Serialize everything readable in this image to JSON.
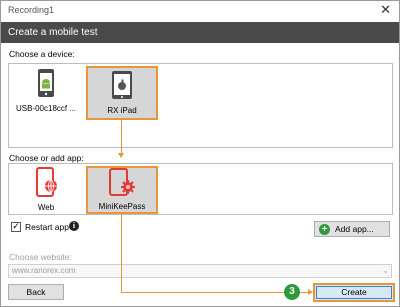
{
  "window": {
    "title": "Recording1",
    "close_glyph": "✕"
  },
  "header": {
    "title": "Create a mobile test"
  },
  "device_section": {
    "label": "Choose a device:",
    "devices": [
      {
        "label": "USB-00c18ccf ...",
        "icon": "android-phone-icon",
        "selected": false
      },
      {
        "label": "RX iPad",
        "icon": "apple-tablet-icon",
        "selected": true
      }
    ]
  },
  "app_section": {
    "label": "Choose or add app:",
    "apps": [
      {
        "label": "Web",
        "icon": "web-browser-app-icon",
        "selected": false
      },
      {
        "label": "MiniKeePass",
        "icon": "app-gear-tablet-icon",
        "selected": true
      }
    ],
    "restart_app_label": "Restart app",
    "restart_app_checked": true,
    "add_app_label": "Add app..."
  },
  "website": {
    "label": "Choose website:",
    "placeholder": "www.ranorex.com"
  },
  "footer": {
    "back_label": "Back",
    "create_label": "Create",
    "step_badge": "3"
  },
  "colors": {
    "header_bg": "#4a4a4a",
    "highlight_orange": "#e8963a",
    "accent_green": "#2e9a3b",
    "app_red": "#e53935"
  }
}
